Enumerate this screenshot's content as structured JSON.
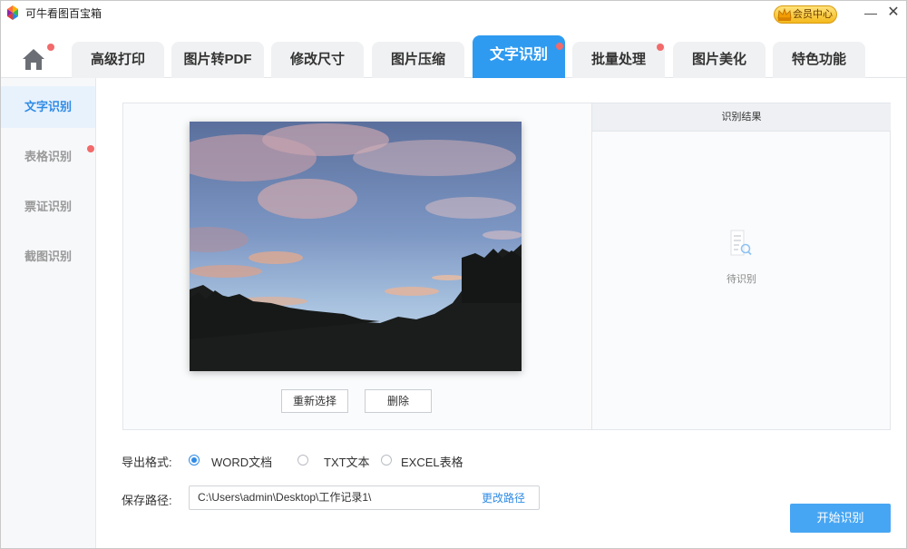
{
  "window": {
    "title": "可牛看图百宝箱",
    "vip_label": "会员中心",
    "minimize_glyph": "—",
    "close_glyph": "✕"
  },
  "tabs": [
    {
      "label": "高级打印"
    },
    {
      "label": "图片转PDF"
    },
    {
      "label": "修改尺寸"
    },
    {
      "label": "图片压缩"
    },
    {
      "label": "文字识别",
      "active": true
    },
    {
      "label": "批量处理"
    },
    {
      "label": "图片美化"
    },
    {
      "label": "特色功能"
    }
  ],
  "sidebar": {
    "items": [
      {
        "label": "文字识别",
        "active": true
      },
      {
        "label": "表格识别"
      },
      {
        "label": "票证识别"
      },
      {
        "label": "截图识别"
      }
    ]
  },
  "preview": {
    "reselect_label": "重新选择",
    "delete_label": "删除"
  },
  "result": {
    "header": "识别结果",
    "status": "待识别"
  },
  "export": {
    "label": "导出格式:",
    "options": [
      {
        "label": "WORD文档",
        "selected": true
      },
      {
        "label": "TXT文本",
        "selected": false
      },
      {
        "label": "EXCEL表格",
        "selected": false
      }
    ]
  },
  "save": {
    "label": "保存路径:",
    "path": "C:\\Users\\admin\\Desktop\\工作记录1\\",
    "change_label": "更改路径"
  },
  "start_label": "开始识别",
  "colors": {
    "accent": "#2f9bf0",
    "notification_dot": "#f26a6a",
    "start_button": "#47a6f3"
  }
}
